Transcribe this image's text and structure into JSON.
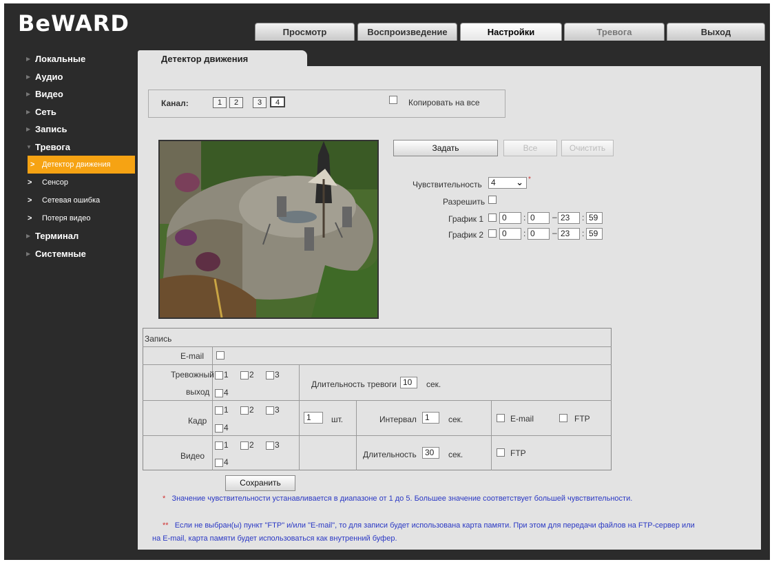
{
  "brand": {
    "logo": "BeWARD"
  },
  "nav_tabs": [
    "Просмотр",
    "Воспроизведение",
    "Настройки",
    "Тревога",
    "Выход"
  ],
  "sidebar": {
    "items": [
      {
        "label": "Локальные"
      },
      {
        "label": "Аудио"
      },
      {
        "label": "Видео"
      },
      {
        "label": "Сеть"
      },
      {
        "label": "Запись"
      },
      {
        "label": "Тревога"
      }
    ],
    "alarm_sub": [
      {
        "label": "Детектор движения"
      },
      {
        "label": "Сенсор"
      },
      {
        "label": "Сетевая ошибка"
      },
      {
        "label": "Потеря видео"
      }
    ],
    "items_after": [
      {
        "label": "Терминал"
      },
      {
        "label": "Системные"
      }
    ]
  },
  "page": {
    "tab_title": "Детектор движения"
  },
  "channel": {
    "label": "Канал:",
    "numbers": [
      "1",
      "2",
      "3",
      "4"
    ],
    "selected": "4",
    "copy_all": "Копировать на все"
  },
  "actions": {
    "set": "Задать",
    "all": "Все",
    "clear": "Очистить"
  },
  "settings": {
    "sensitivity_label": "Чувствительность",
    "sensitivity_value": "4",
    "enable_label": "Разрешить",
    "schedule1_label": "График 1",
    "schedule1": {
      "h1": "0",
      "m1": "0",
      "h2": "23",
      "m2": "59"
    },
    "schedule2_label": "График 2",
    "schedule2": {
      "h1": "0",
      "m1": "0",
      "h2": "23",
      "m2": "59"
    }
  },
  "record": {
    "header": "Запись",
    "email_label": "E-mail",
    "alarm_out_label_1": "Тревожный",
    "alarm_out_label_2": "выход",
    "alarm_duration_label": "Длительность тревоги",
    "alarm_duration_value": "10",
    "sec": "сек.",
    "frame_label": "Кадр",
    "frame_count": "1",
    "pcs": "шт.",
    "interval_label": "Интервал",
    "interval_value": "1",
    "email_opt": "E-mail",
    "ftp_opt": "FTP",
    "video_label": "Видео",
    "duration_label": "Длительность",
    "duration_value": "30",
    "ch1": "1",
    "ch2": "2",
    "ch3": "3",
    "ch4": "4"
  },
  "save_label": "Сохранить",
  "notes": {
    "note1_star": "*",
    "note1": "Значение чувствительности устанавливается в диапазоне от 1 до 5. Большее значение соответствует большей чувствительности.",
    "note2_star": "**",
    "note2_line1": "Если не выбран(ы) пункт \"FTP\" и/или \"E-mail\", то для записи будет использована карта памяти. При этом для передачи файлов на FTP-сервер или",
    "note2_line2": "на E-mail, карта памяти будет использоваться как внутренний буфер."
  }
}
